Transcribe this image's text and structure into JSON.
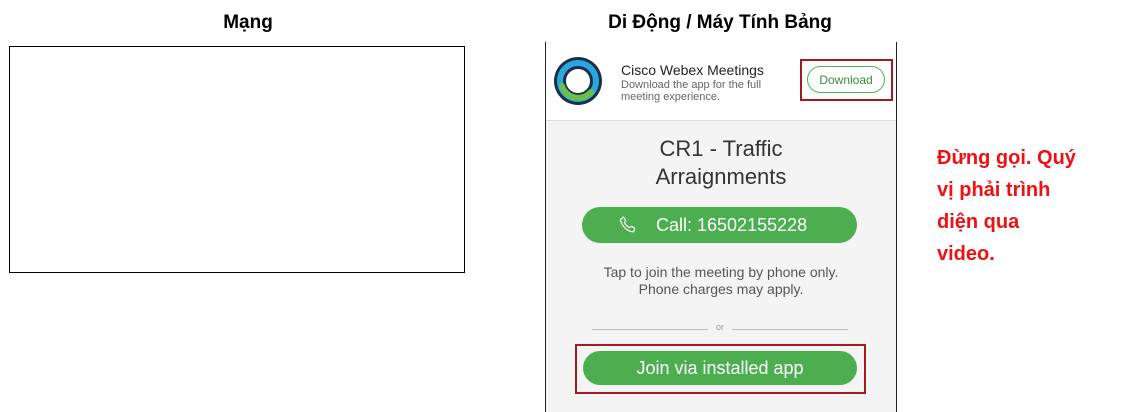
{
  "headings": {
    "web": "Mạng",
    "mobile": "Di Động / Máy Tính Bảng"
  },
  "banner": {
    "app_name": "Cisco Webex Meetings",
    "app_desc": "Download the app for the full meeting experience.",
    "download_label": "Download"
  },
  "meeting": {
    "title_line1": "CR1 - Traffic",
    "title_line2": "Arraignments",
    "call_label": "Call: 16502155228",
    "tap_line1": "Tap to join the meeting by phone only.",
    "tap_line2": "Phone charges may apply.",
    "or_text": "or",
    "join_label": "Join via installed app"
  },
  "warning": {
    "line1": "Đừng gọi. Quý",
    "line2": "vị phải trình",
    "line3": "diện qua",
    "line4": "video."
  },
  "colors": {
    "accent_green": "#4cae4f",
    "highlight_red": "#a01c22",
    "warning_red": "#ee1111"
  }
}
